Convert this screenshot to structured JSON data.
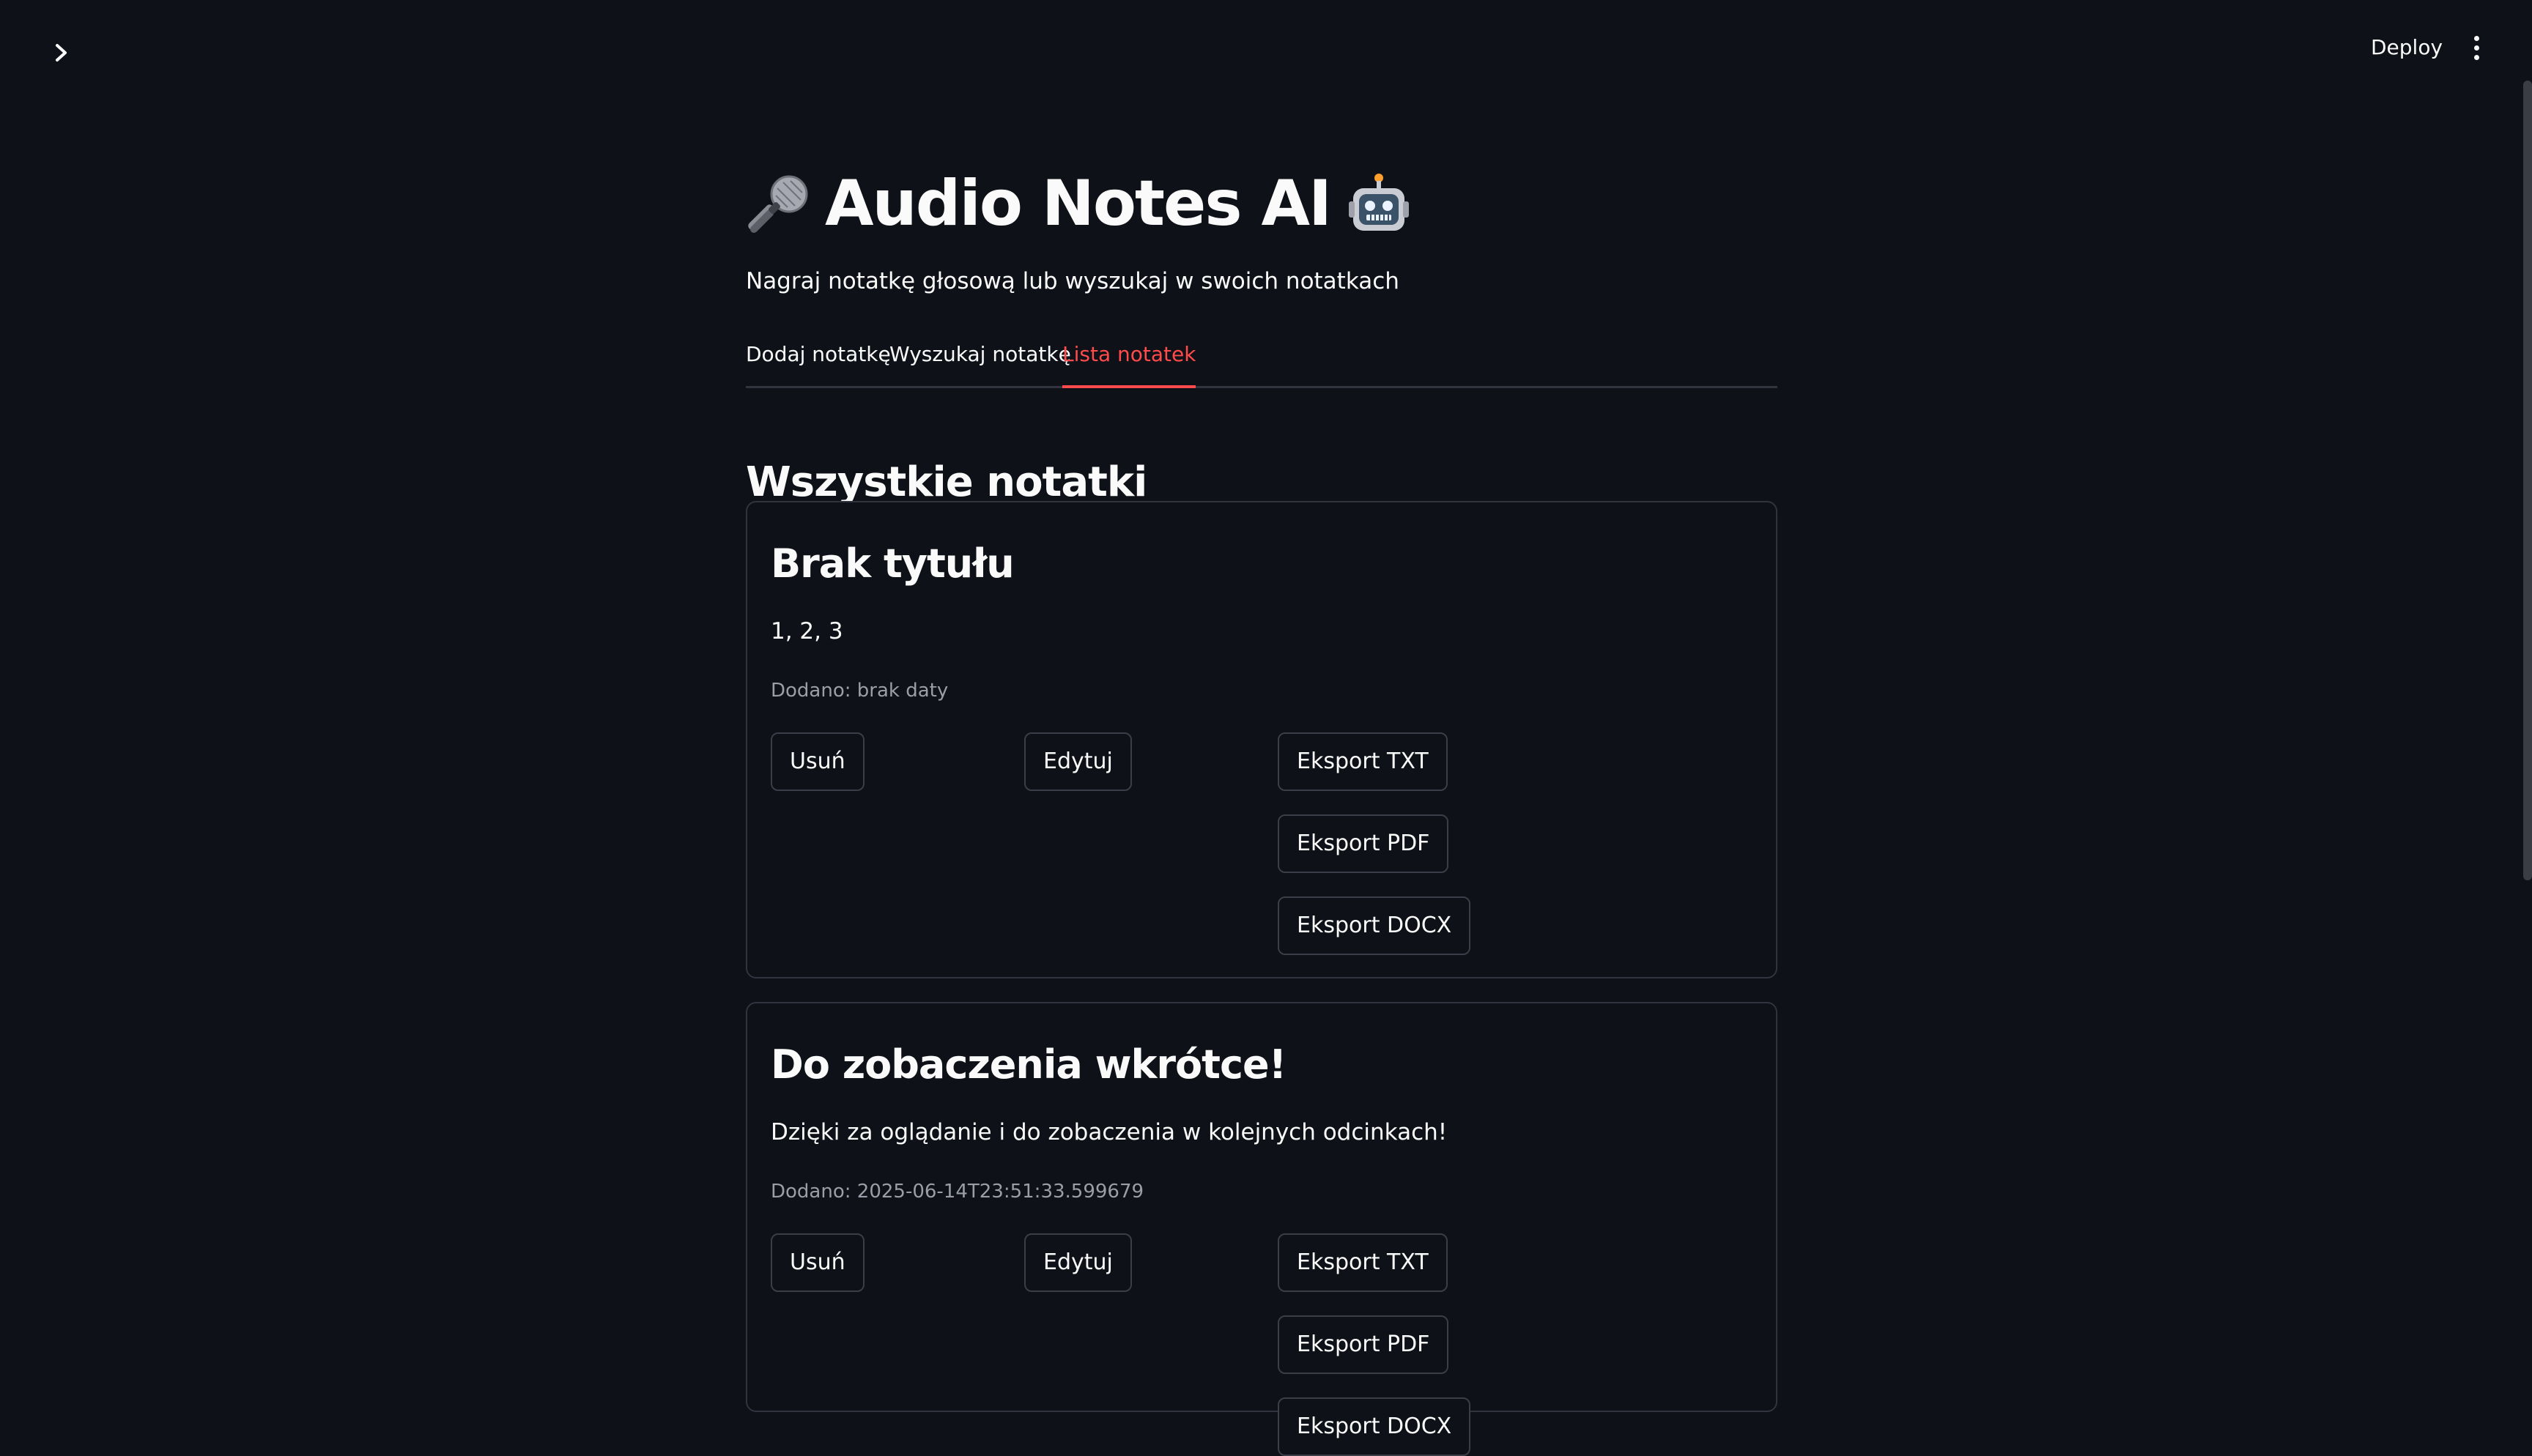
{
  "header": {
    "deploy_label": "Deploy"
  },
  "app": {
    "title": "Audio Notes AI",
    "title_icon_left": "microphone-icon",
    "title_icon_right": "robot-icon",
    "subtitle": "Nagraj notatkę głosową lub wyszukaj w swoich notatkach"
  },
  "tabs": [
    {
      "label": "Dodaj notatkę",
      "active": false
    },
    {
      "label": "Wyszukaj notatkę",
      "active": false
    },
    {
      "label": "Lista notatek",
      "active": true
    }
  ],
  "section": {
    "heading": "Wszystkie notatki"
  },
  "notes": [
    {
      "title": "Brak tytułu",
      "content": "1, 2, 3",
      "date": "Dodano: brak daty",
      "buttons": {
        "delete": "Usuń",
        "edit": "Edytuj",
        "export_txt": "Eksport TXT",
        "export_pdf": "Eksport PDF",
        "export_docx": "Eksport DOCX"
      }
    },
    {
      "title": "Do zobaczenia wkrótce!",
      "content": "Dzięki za oglądanie i do zobaczenia w kolejnych odcinkach!",
      "date": "Dodano: 2025-06-14T23:51:33.599679",
      "buttons": {
        "delete": "Usuń",
        "edit": "Edytuj",
        "export_txt": "Eksport TXT",
        "export_pdf": "Eksport PDF",
        "export_docx": "Eksport DOCX"
      }
    }
  ],
  "colors": {
    "background": "#0e1117",
    "accent": "#ff4b4b",
    "border": "#31333f",
    "muted_text": "#9b9ea8"
  }
}
